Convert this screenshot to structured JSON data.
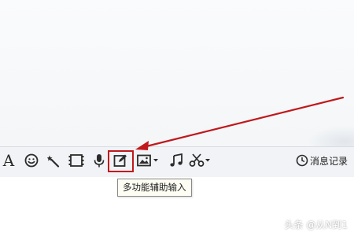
{
  "toolbar": {
    "font_glyph": "A",
    "tools": [
      {
        "name": "font",
        "icon": "font-icon"
      },
      {
        "name": "emoji",
        "icon": "smiley-icon"
      },
      {
        "name": "magic",
        "icon": "magic-wand-icon"
      },
      {
        "name": "video",
        "icon": "video-icon"
      },
      {
        "name": "voice",
        "icon": "microphone-icon"
      },
      {
        "name": "multi-input",
        "icon": "edit-icon"
      },
      {
        "name": "image",
        "icon": "image-icon"
      },
      {
        "name": "music",
        "icon": "music-icon"
      },
      {
        "name": "screenshot",
        "icon": "scissors-icon"
      }
    ],
    "history_label": "消息记录"
  },
  "tooltip": {
    "text": "多功能辅助输入"
  },
  "watermark": {
    "text": "头条 @从N到1"
  },
  "colors": {
    "annotation_red": "#c0181c",
    "tooltip_bg": "#fdfdf3",
    "toolbar_bg": "#f1f3f6",
    "icon_dark": "#2b2b2b"
  }
}
